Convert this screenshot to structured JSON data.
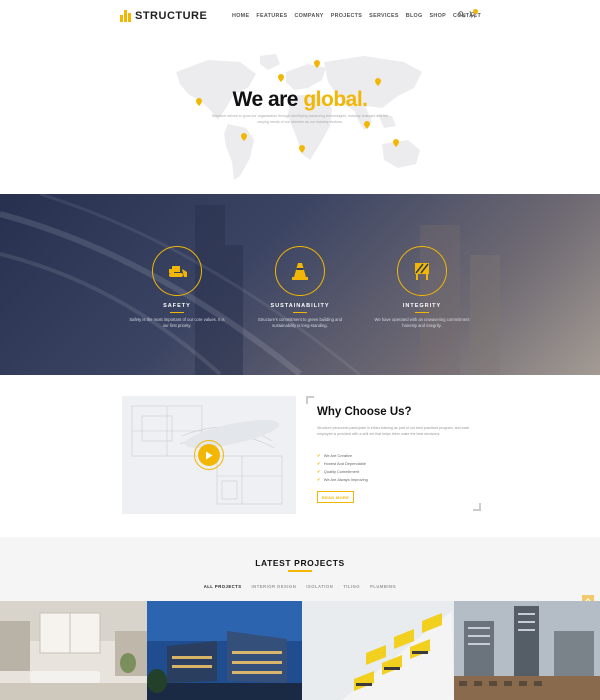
{
  "header": {
    "logo_text": "STRUCTURE",
    "nav": [
      "HOME",
      "FEATURES",
      "COMPANY",
      "PROJECTS",
      "SERVICES",
      "BLOG",
      "SHOP",
      "CONTACT"
    ],
    "search_icon": "search-icon",
    "cart_icon": "cart-icon",
    "cart_count": "0"
  },
  "hero": {
    "title_main": "We are ",
    "title_accent": "global.",
    "subtitle": "Structure strives to grow our organization through identifying advancing technologies, industry changes and the varying needs of our clientele as our industry evolves."
  },
  "values": [
    {
      "icon": "bulldozer-icon",
      "title": "SAFETY",
      "text": "Safety is the most important of our core values. It is our first priority."
    },
    {
      "icon": "traffic-cone-icon",
      "title": "SUSTAINABILITY",
      "text": "Structure's commitment to green building and sustainability is long-standing."
    },
    {
      "icon": "barrier-icon",
      "title": "INTEGRITY",
      "text": "We have operated with an unwavering commitment honesty and integrity."
    }
  ],
  "why": {
    "title": "Why Choose Us?",
    "text": "Structure personnel participate in ethics training as part of our best practices program, and each employee is provided with a skill set that helps them make the best decisions.",
    "list": [
      "We Are Creative",
      "Honest And Dependable",
      "Quality Commitment",
      "We Are Always Improving"
    ],
    "button": "READ MORE"
  },
  "projects": {
    "title": "LATEST PROJECTS",
    "filters": [
      "ALL PROJECTS",
      "INTERIOR DESIGN",
      "ISOLATION",
      "TILING",
      "PLUMBING"
    ],
    "active_filter": 0
  },
  "colors": {
    "accent": "#f2b705",
    "band": "#27314f"
  }
}
